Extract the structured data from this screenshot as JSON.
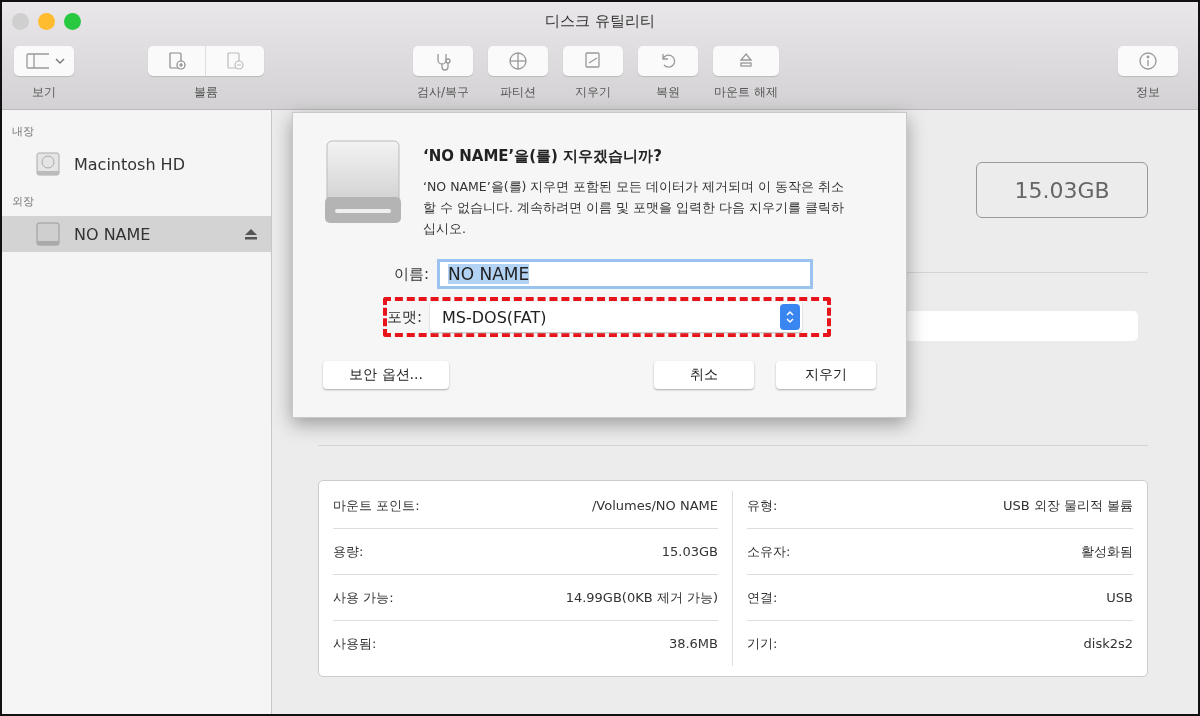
{
  "window": {
    "title": "디스크 유틸리티",
    "traffic_lights": [
      {
        "color": "#cfcfcf"
      },
      {
        "color": "#febc2e"
      },
      {
        "color": "#28c840"
      }
    ]
  },
  "toolbar": {
    "left": [
      {
        "kind": "view",
        "label": "보기"
      },
      {
        "kind": "volume",
        "label": "볼륨"
      }
    ],
    "center": [
      {
        "kind": "firstaid",
        "label": "검사/복구"
      },
      {
        "kind": "partition",
        "label": "파티션"
      },
      {
        "kind": "erase",
        "label": "지우기"
      },
      {
        "kind": "restore",
        "label": "복원"
      },
      {
        "kind": "unmount",
        "label": "마운트 해제"
      }
    ],
    "right": [
      {
        "kind": "info",
        "label": "정보"
      }
    ]
  },
  "sidebar": {
    "sections": [
      {
        "heading": "내장",
        "items": [
          {
            "name": "Macintosh HD",
            "kind": "internal",
            "selected": false,
            "ejectable": false
          }
        ]
      },
      {
        "heading": "외장",
        "items": [
          {
            "name": "NO NAME",
            "kind": "external",
            "selected": true,
            "ejectable": true
          }
        ]
      }
    ]
  },
  "main": {
    "capacity": "15.03GB",
    "info_left": [
      {
        "label": "마운트 포인트:",
        "value": "/Volumes/NO NAME"
      },
      {
        "label": "용량:",
        "value": "15.03GB"
      },
      {
        "label": "사용 가능:",
        "value": "14.99GB(0KB 제거 가능)"
      },
      {
        "label": "사용됨:",
        "value": "38.6MB"
      }
    ],
    "info_right": [
      {
        "label": "유형:",
        "value": "USB 외장 물리적 볼륨"
      },
      {
        "label": "소유자:",
        "value": "활성화됨"
      },
      {
        "label": "연결:",
        "value": "USB"
      },
      {
        "label": "기기:",
        "value": "disk2s2"
      }
    ]
  },
  "dialog": {
    "title": "‘NO NAME’을(를) 지우겠습니까?",
    "message": "‘NO NAME’을(를) 지우면 포함된 모든 데이터가 제거되며 이 동작은 취소할 수 없습니다. 계속하려면 이름 및 포맷을 입력한 다음 지우기를 클릭하십시오.",
    "name_label": "이름:",
    "name_value": "NO NAME",
    "name_selected": true,
    "format_label": "포맷:",
    "format_value": "MS-DOS(FAT)",
    "format_highlighted": true,
    "buttons": [
      "보안 옵션...",
      "취소",
      "지우기"
    ]
  }
}
